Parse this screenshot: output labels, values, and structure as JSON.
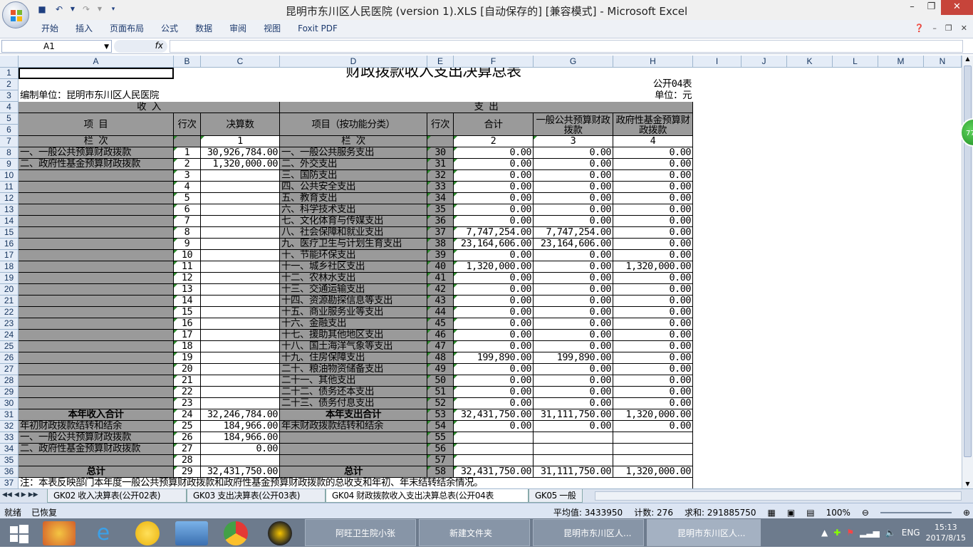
{
  "window": {
    "title": "昆明市东川区人民医院 (version 1).XLS [自动保存的]  [兼容模式] - Microsoft Excel"
  },
  "ribbon": {
    "tabs": [
      "开始",
      "插入",
      "页面布局",
      "公式",
      "数据",
      "审阅",
      "视图",
      "Foxit PDF"
    ]
  },
  "formula_bar": {
    "name_box": "A1",
    "fx": "fx",
    "content": ""
  },
  "columns": [
    "A",
    "B",
    "C",
    "D",
    "E",
    "F",
    "G",
    "H",
    "I",
    "J",
    "K",
    "L",
    "M",
    "N"
  ],
  "report": {
    "title": "财政拨款收入支出决算总表",
    "form_no": "公开04表",
    "unit_label": "编制单位：昆明市东川区人民医院",
    "currency": "单位：元",
    "income_header": "收          入",
    "expense_header": "支          出",
    "h_item": "项          目",
    "h_line": "行次",
    "h_amount": "决算数",
    "h_func_item": "项目（按功能分类）",
    "h_total": "合计",
    "h_general": "一般公共预算财政拨款",
    "h_fund": "政府性基金预算财政拨款",
    "col_label": "栏          次",
    "n1": "1",
    "n2": "2",
    "n3": "3",
    "n4": "4",
    "note": "注：本表反映部门本年度一般公共预算财政拨款和政府性基金预算财政拨款的总收支和年初、年末结转结余情况。"
  },
  "rows": [
    {
      "r": 8,
      "inc": "一、一般公共预算财政拨款",
      "l": "1",
      "amt": "30,926,784.00",
      "exp": "一、一般公共服务支出",
      "el": "30",
      "t": "0.00",
      "g": "0.00",
      "f": "0.00"
    },
    {
      "r": 9,
      "inc": "二、政府性基金预算财政拨款",
      "l": "2",
      "amt": "1,320,000.00",
      "exp": "二、外交支出",
      "el": "31",
      "t": "0.00",
      "g": "0.00",
      "f": "0.00"
    },
    {
      "r": 10,
      "inc": "",
      "l": "3",
      "amt": "",
      "exp": "三、国防支出",
      "el": "32",
      "t": "0.00",
      "g": "0.00",
      "f": "0.00"
    },
    {
      "r": 11,
      "inc": "",
      "l": "4",
      "amt": "",
      "exp": "四、公共安全支出",
      "el": "33",
      "t": "0.00",
      "g": "0.00",
      "f": "0.00"
    },
    {
      "r": 12,
      "inc": "",
      "l": "5",
      "amt": "",
      "exp": "五、教育支出",
      "el": "34",
      "t": "0.00",
      "g": "0.00",
      "f": "0.00"
    },
    {
      "r": 13,
      "inc": "",
      "l": "6",
      "amt": "",
      "exp": "六、科学技术支出",
      "el": "35",
      "t": "0.00",
      "g": "0.00",
      "f": "0.00"
    },
    {
      "r": 14,
      "inc": "",
      "l": "7",
      "amt": "",
      "exp": "七、文化体育与传媒支出",
      "el": "36",
      "t": "0.00",
      "g": "0.00",
      "f": "0.00"
    },
    {
      "r": 15,
      "inc": "",
      "l": "8",
      "amt": "",
      "exp": "八、社会保障和就业支出",
      "el": "37",
      "t": "7,747,254.00",
      "g": "7,747,254.00",
      "f": "0.00"
    },
    {
      "r": 16,
      "inc": "",
      "l": "9",
      "amt": "",
      "exp": "九、医疗卫生与计划生育支出",
      "el": "38",
      "t": "23,164,606.00",
      "g": "23,164,606.00",
      "f": "0.00"
    },
    {
      "r": 17,
      "inc": "",
      "l": "10",
      "amt": "",
      "exp": "十、节能环保支出",
      "el": "39",
      "t": "0.00",
      "g": "0.00",
      "f": "0.00"
    },
    {
      "r": 18,
      "inc": "",
      "l": "11",
      "amt": "",
      "exp": "十一、城乡社区支出",
      "el": "40",
      "t": "1,320,000.00",
      "g": "0.00",
      "f": "1,320,000.00"
    },
    {
      "r": 19,
      "inc": "",
      "l": "12",
      "amt": "",
      "exp": "十二、农林水支出",
      "el": "41",
      "t": "0.00",
      "g": "0.00",
      "f": "0.00"
    },
    {
      "r": 20,
      "inc": "",
      "l": "13",
      "amt": "",
      "exp": "十三、交通运输支出",
      "el": "42",
      "t": "0.00",
      "g": "0.00",
      "f": "0.00"
    },
    {
      "r": 21,
      "inc": "",
      "l": "14",
      "amt": "",
      "exp": "十四、资源勘探信息等支出",
      "el": "43",
      "t": "0.00",
      "g": "0.00",
      "f": "0.00"
    },
    {
      "r": 22,
      "inc": "",
      "l": "15",
      "amt": "",
      "exp": "十五、商业服务业等支出",
      "el": "44",
      "t": "0.00",
      "g": "0.00",
      "f": "0.00"
    },
    {
      "r": 23,
      "inc": "",
      "l": "16",
      "amt": "",
      "exp": "十六、金融支出",
      "el": "45",
      "t": "0.00",
      "g": "0.00",
      "f": "0.00"
    },
    {
      "r": 24,
      "inc": "",
      "l": "17",
      "amt": "",
      "exp": "十七、援助其他地区支出",
      "el": "46",
      "t": "0.00",
      "g": "0.00",
      "f": "0.00"
    },
    {
      "r": 25,
      "inc": "",
      "l": "18",
      "amt": "",
      "exp": "十八、国土海洋气象等支出",
      "el": "47",
      "t": "0.00",
      "g": "0.00",
      "f": "0.00"
    },
    {
      "r": 26,
      "inc": "",
      "l": "19",
      "amt": "",
      "exp": "十九、住房保障支出",
      "el": "48",
      "t": "199,890.00",
      "g": "199,890.00",
      "f": "0.00"
    },
    {
      "r": 27,
      "inc": "",
      "l": "20",
      "amt": "",
      "exp": "二十、粮油物资储备支出",
      "el": "49",
      "t": "0.00",
      "g": "0.00",
      "f": "0.00"
    },
    {
      "r": 28,
      "inc": "",
      "l": "21",
      "amt": "",
      "exp": "二十一、其他支出",
      "el": "50",
      "t": "0.00",
      "g": "0.00",
      "f": "0.00"
    },
    {
      "r": 29,
      "inc": "",
      "l": "22",
      "amt": "",
      "exp": "二十二、债务还本支出",
      "el": "51",
      "t": "0.00",
      "g": "0.00",
      "f": "0.00"
    },
    {
      "r": 30,
      "inc": "",
      "l": "23",
      "amt": "",
      "exp": "二十三、债务付息支出",
      "el": "52",
      "t": "0.00",
      "g": "0.00",
      "f": "0.00"
    },
    {
      "r": 31,
      "inc": "本年收入合计",
      "l": "24",
      "amt": "32,246,784.00",
      "exp": "本年支出合计",
      "el": "53",
      "t": "32,431,750.00",
      "g": "31,111,750.00",
      "f": "1,320,000.00",
      "bold": true
    },
    {
      "r": 32,
      "inc": "年初财政拨款结转和结余",
      "l": "25",
      "amt": "184,966.00",
      "exp": "年末财政拨款结转和结余",
      "el": "54",
      "t": "0.00",
      "g": "0.00",
      "f": "0.00"
    },
    {
      "r": 33,
      "inc": "一、一般公共预算财政拨款",
      "l": "26",
      "amt": "184,966.00",
      "exp": "",
      "el": "55",
      "t": "",
      "g": "",
      "f": ""
    },
    {
      "r": 34,
      "inc": "二、政府性基金预算财政拨款",
      "l": "27",
      "amt": "0.00",
      "exp": "",
      "el": "56",
      "t": "",
      "g": "",
      "f": ""
    },
    {
      "r": 35,
      "inc": "",
      "l": "28",
      "amt": "",
      "exp": "",
      "el": "57",
      "t": "",
      "g": "",
      "f": ""
    },
    {
      "r": 36,
      "inc": "总计",
      "l": "29",
      "amt": "32,431,750.00",
      "exp": "总计",
      "el": "58",
      "t": "32,431,750.00",
      "g": "31,111,750.00",
      "f": "1,320,000.00",
      "bold": true
    }
  ],
  "sheets": [
    "GK02 收入决算表(公开02表)",
    "GK03 支出决算表(公开03表)",
    "GK04 财政拨款收入支出决算总表(公开04表",
    "GK05 一般"
  ],
  "status": {
    "ready": "就绪",
    "recovered": "已恢复",
    "avg": "平均值: 3433950",
    "count": "计数: 276",
    "sum": "求和: 291885750",
    "zoom": "100%"
  },
  "taskbar": {
    "tasks": [
      "阿旺卫生院小张",
      "新建文件夹",
      "昆明市东川区人...",
      "昆明市东川区人..."
    ],
    "lang": "ENG",
    "time": "15:13",
    "date": "2017/8/15"
  },
  "badge": "77"
}
